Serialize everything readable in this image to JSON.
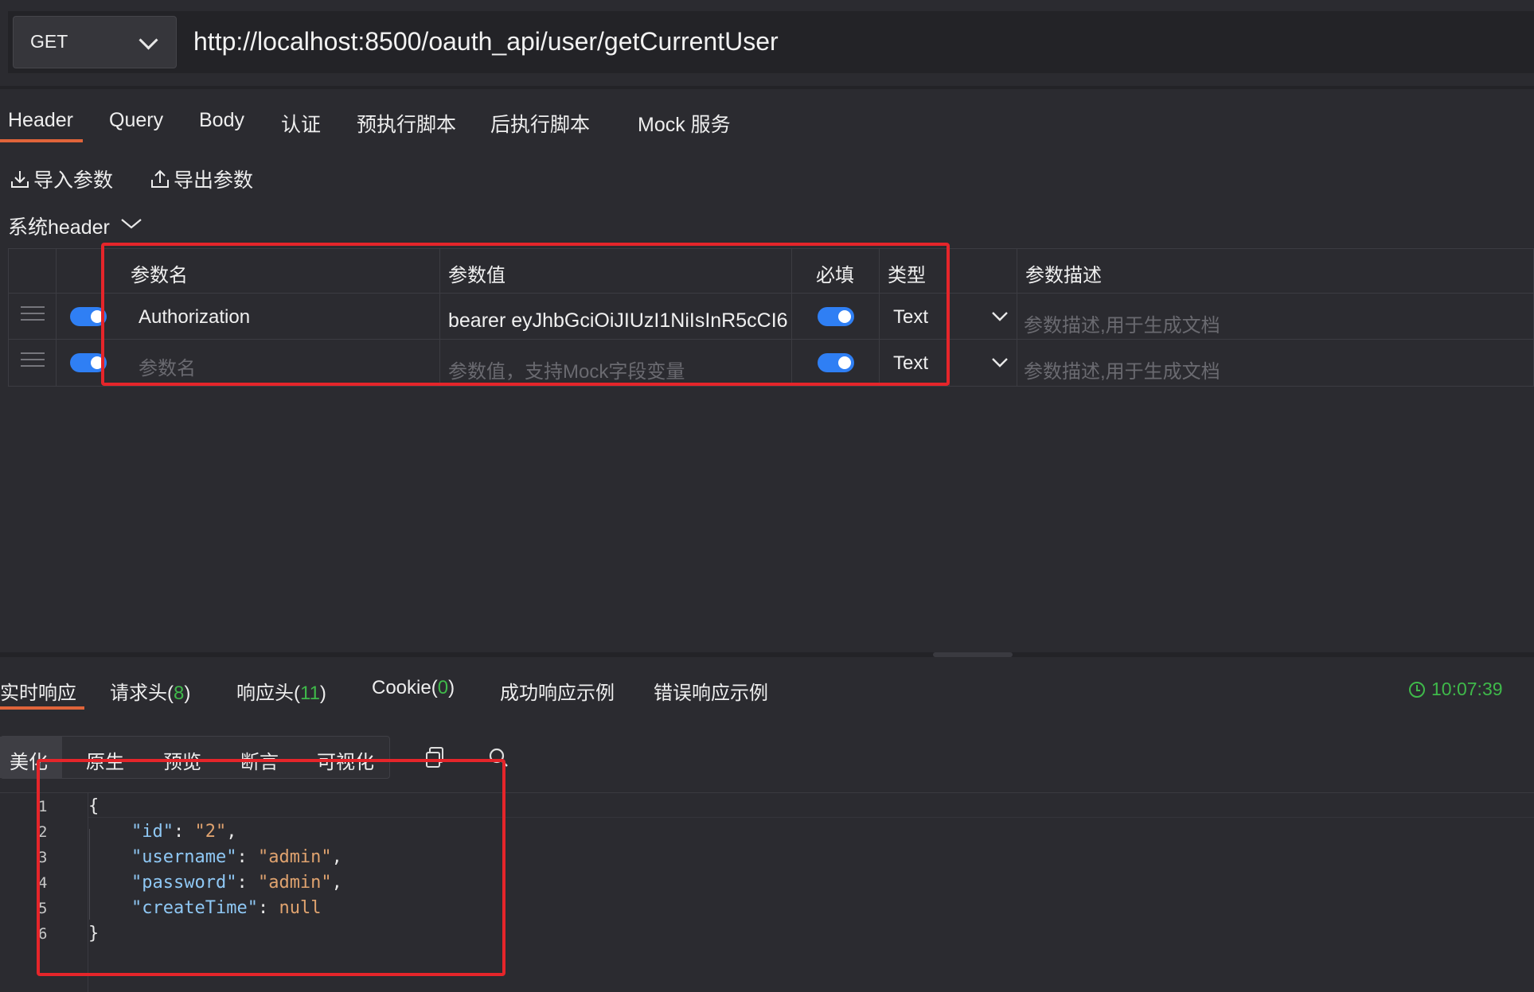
{
  "request": {
    "method": "GET",
    "url": "http://localhost:8500/oauth_api/user/getCurrentUser"
  },
  "tabs": [
    "Header",
    "Query",
    "Body",
    "认证",
    "预执行脚本",
    "后执行脚本",
    "Mock 服务"
  ],
  "actions": {
    "import_label": "导入参数",
    "export_label": "导出参数"
  },
  "system_header_label": "系统header",
  "param_table": {
    "headers": {
      "name": "参数名",
      "value": "参数值",
      "required": "必填",
      "type": "类型",
      "desc": "参数描述"
    },
    "rows": [
      {
        "name": "Authorization",
        "value": "bearer eyJhbGciOiJIUzI1NiIsInR5cCI6",
        "type": "Text",
        "desc_placeholder": "参数描述,用于生成文档",
        "enabled": true,
        "required": true
      },
      {
        "name_placeholder": "参数名",
        "value_placeholder": "参数值，支持Mock字段变量",
        "type": "Text",
        "desc_placeholder": "参数描述,用于生成文档",
        "enabled": true,
        "required": true
      }
    ]
  },
  "response_tabs": {
    "live": "实时响应",
    "req_headers_label": "请求头(",
    "req_headers_count": "8",
    "req_headers_close": ")",
    "resp_headers_label": "响应头(",
    "resp_headers_count": "11",
    "resp_headers_close": ")",
    "cookie_label": "Cookie(",
    "cookie_count": "0",
    "cookie_close": ")",
    "success_example": "成功响应示例",
    "error_example": "错误响应示例",
    "time": "10:07:39"
  },
  "view_modes": [
    "美化",
    "原生",
    "预览",
    "断言",
    "可视化"
  ],
  "code": {
    "line_numbers": [
      "1",
      "2",
      "3",
      "4",
      "5",
      "6"
    ],
    "lines": [
      {
        "open": "{"
      },
      {
        "key": "\"id\"",
        "value": "\"2\"",
        "trail": ","
      },
      {
        "key": "\"username\"",
        "value": "\"admin\"",
        "trail": ","
      },
      {
        "key": "\"password\"",
        "value": "\"admin\"",
        "trail": ","
      },
      {
        "key": "\"createTime\"",
        "value": "null",
        "trail": ""
      },
      {
        "close": "}"
      }
    ]
  },
  "colors": {
    "accent": "#e0643a",
    "toggle": "#2f7ff4",
    "highlight_box": "#e5252a",
    "success": "#3fb94a"
  }
}
